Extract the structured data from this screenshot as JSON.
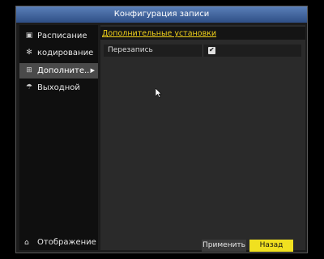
{
  "window": {
    "title": "Конфигурация записи"
  },
  "sidebar": {
    "items": [
      {
        "label": "Расписание",
        "icon": "schedule-icon"
      },
      {
        "label": "кодирование",
        "icon": "gear-icon"
      },
      {
        "label": "Дополните...",
        "icon": "advanced-icon",
        "active": true
      },
      {
        "label": "Выходной",
        "icon": "holiday-icon"
      }
    ],
    "back": {
      "label": "Отображение",
      "icon": "home-icon"
    }
  },
  "content": {
    "section_title": "Дополнительные установки",
    "rows": [
      {
        "label": "Перезапись",
        "checked": true
      }
    ]
  },
  "buttons": {
    "apply": "Применить",
    "back": "Назад"
  },
  "colors": {
    "accent": "#f0e020",
    "title_bar": "#3f64a0"
  }
}
